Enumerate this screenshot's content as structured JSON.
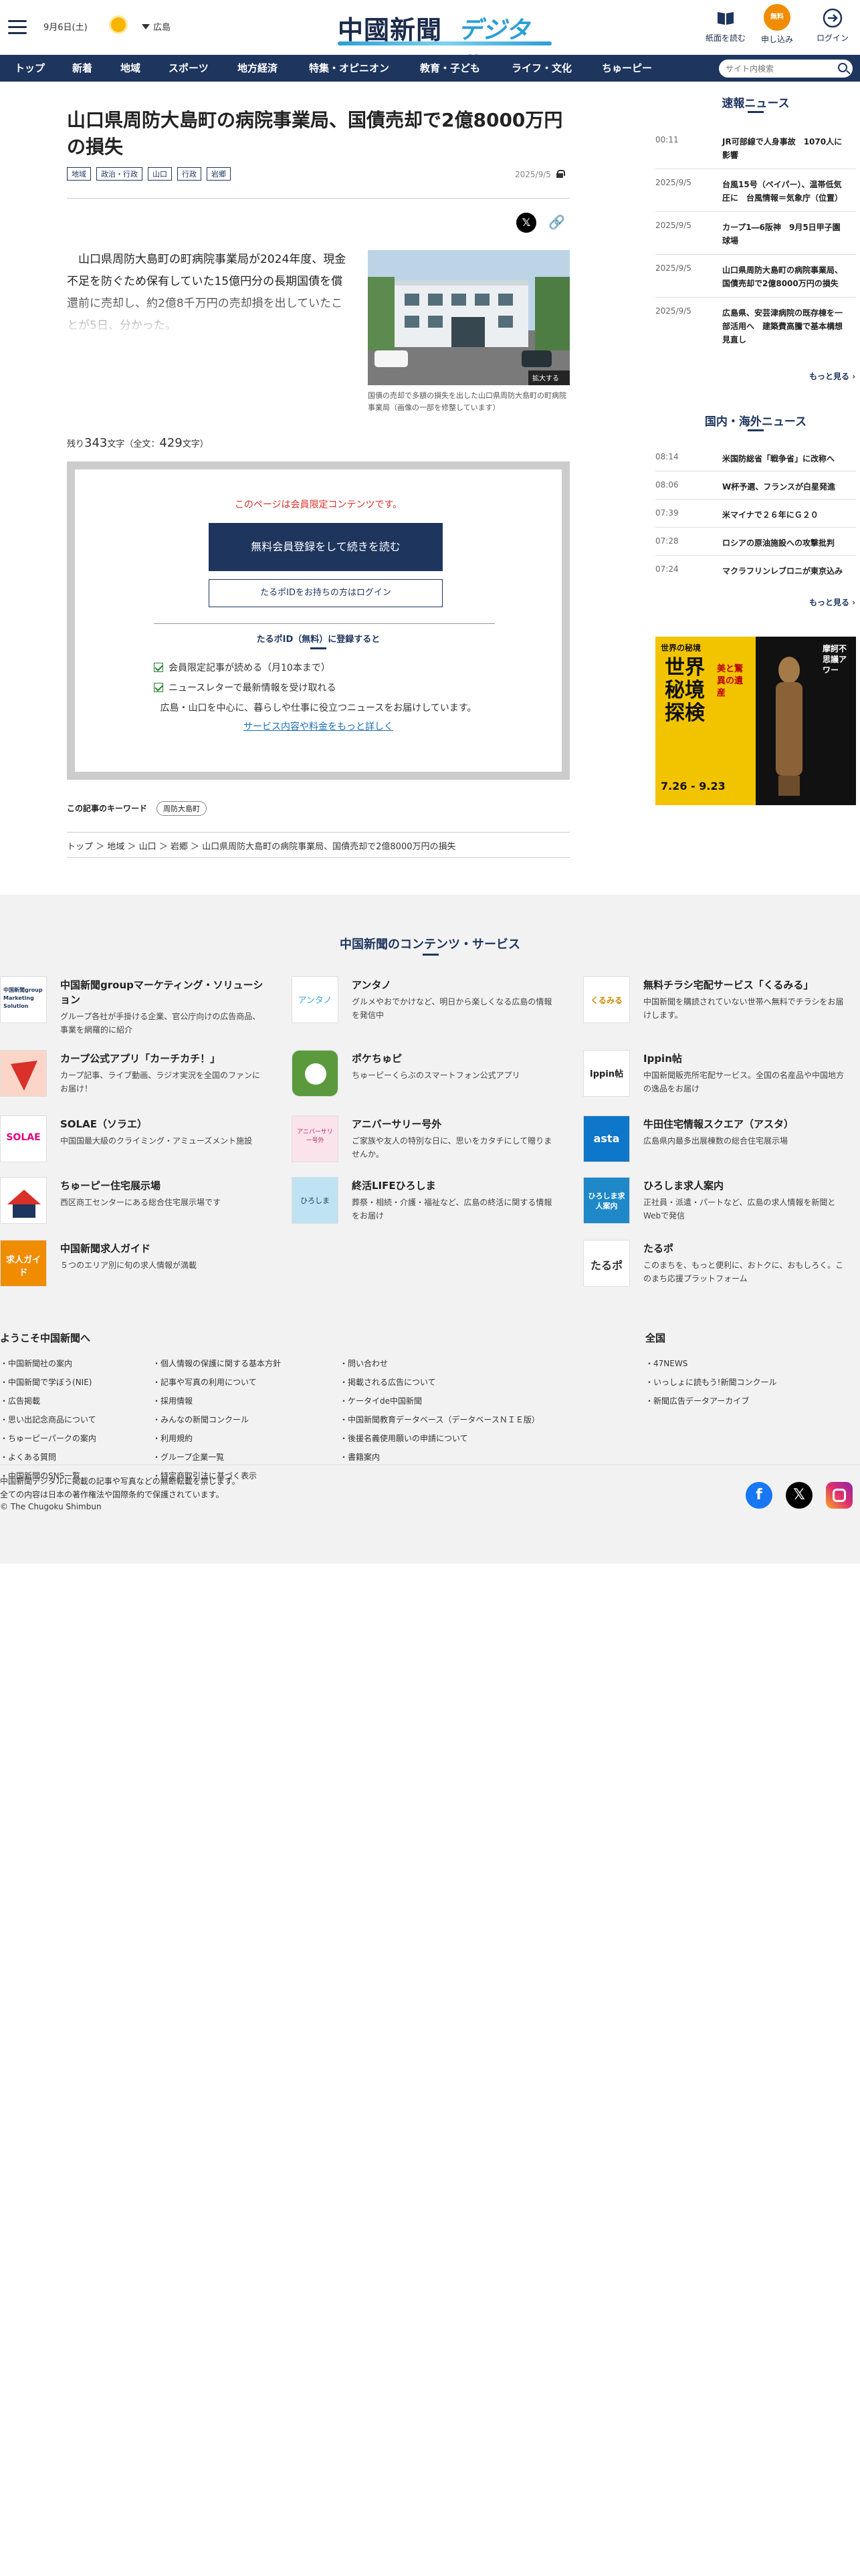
{
  "header": {
    "date": "9月6日(土)",
    "region": "広島",
    "logo_kanji": "中國新聞",
    "logo_kana": "デジタル",
    "buttons": {
      "paper": "紙面を読む",
      "signup": "申し込み",
      "signup_badge": "無料",
      "login": "ログイン"
    }
  },
  "nav": {
    "items": [
      "トップ",
      "新着",
      "地域",
      "スポーツ",
      "地方経済",
      "特集・オピニオン",
      "教育・子ども",
      "ライフ・文化",
      "ちゅーピー"
    ],
    "search_placeholder": "サイト内検索"
  },
  "article": {
    "title": "山口県周防大島町の病院事業局、国債売却で2億8000万円の損失",
    "tags": [
      "地域",
      "政治・行政",
      "山口",
      "行政",
      "岩郷"
    ],
    "date": "2025/9/5",
    "lead": "　山口県周防大島町の町病院事業局が2024年度、現金不足を防ぐため保有していた15億円分の長期国債を償還前に売却し、約2億8千万円の売却損を出していたことが5日、分かった。",
    "photo_caption": "国債の売却で多額の損失を出した山口県周防大島町の町病院事業局（画像の一部を修整しています）",
    "photo_zoom": "拡大する",
    "remain_prefix": "残り",
    "remain_count": "343",
    "remain_mid": "文字（全文：",
    "total_count": "429",
    "remain_suffix": "文字）"
  },
  "paywall": {
    "notice": "このページは会員限定コンテンツです。",
    "register_button": "無料会員登録をして続きを読む",
    "login_button": "たるポIDをお持ちの方はログイン",
    "benefits_title": "たるポID（無料）に登録すると",
    "benefit1": "会員限定記事が読める（月10本まで）",
    "benefit2": "ニュースレターで最新情報を受け取れる",
    "description": "広島・山口を中心に、暮らしや仕事に役立つニュースをお届けしています。",
    "more_link": "サービス内容や料金をもっと詳しく"
  },
  "keywords": {
    "label": "この記事のキーワード",
    "tag": "周防大島町"
  },
  "breadcrumb": [
    "トップ",
    "地域",
    "山口",
    "岩郷",
    "山口県周防大島町の病院事業局、国債売却で2億8000万円の損失"
  ],
  "sidebar": {
    "breaking_title": "速報ニュース",
    "breaking": [
      {
        "time": "00:11",
        "headline": "JR可部線で人身事故　1070人に影響"
      },
      {
        "time": "2025/9/5",
        "headline": "台風15号（ペイパー）、温帯低気圧に　台風情報＝気象庁（位置）"
      },
      {
        "time": "2025/9/5",
        "headline": "カープ1―6阪神　9月5日甲子園球場"
      },
      {
        "time": "2025/9/5",
        "headline": "山口県周防大島町の病院事業局、国債売却で2億8000万円の損失"
      },
      {
        "time": "2025/9/5",
        "headline": "広島県、安芸津病院の既存棟を一部活用へ　建築費高騰で基本構想見直し"
      }
    ],
    "more": "もっと見る",
    "world_title": "国内・海外ニュース",
    "world": [
      {
        "time": "08:14",
        "headline": "米国防総省「戦争省」に改称へ"
      },
      {
        "time": "08:06",
        "headline": "W杯予選、フランスが白星発進"
      },
      {
        "time": "07:39",
        "headline": "米マイナで２６年にＧ２０"
      },
      {
        "time": "07:28",
        "headline": "ロシアの原油施設への攻撃批判"
      },
      {
        "time": "07:24",
        "headline": "マクラフリンレブロニが東京込み"
      }
    ],
    "ad": {
      "top": "世界の秘境",
      "main": "世界秘境探検",
      "sub": "美と驚異の遺産",
      "dates": "7.26 - 9.23",
      "right": "摩訶不思議アワー"
    }
  },
  "footer": {
    "title": "中国新聞のコンテンツ・サービス",
    "services": [
      {
        "name": "中国新聞groupマーケティング・ソリューション",
        "desc": "グループ各社が手掛ける企業、官公庁向けの広告商品、事業を網羅的に紹介",
        "icon_text": "中国新聞group Marketing Solution"
      },
      {
        "name": "アンタノ",
        "desc": "グルメやおでかけなど、明日から楽しくなる広島の情報を発信中",
        "icon_text": "アンタノ"
      },
      {
        "name": "無料チラシ宅配サービス「くるみる」",
        "desc": "中国新聞を購読されていない世帯へ無料でチラシをお届けします。",
        "icon_text": "くるみる"
      },
      {
        "name": "カープ公式アプリ「カーチカチ！」",
        "desc": "カープ記事、ライブ動画、ラジオ実況を全国のファンにお届け！",
        "icon_text": ""
      },
      {
        "name": "ポケちゅピ",
        "desc": "ちゅーピーくらぶのスマートフォン公式アプリ",
        "icon_text": ""
      },
      {
        "name": "Ippin帖",
        "desc": "中国新聞販売所宅配サービス。全国の名産品や中国地方の逸品をお届け",
        "icon_text": "Ippin帖"
      },
      {
        "name": "SOLAE（ソラエ）",
        "desc": "中国国最大級のクライミング・アミューズメント施設",
        "icon_text": "SOLAE"
      },
      {
        "name": "アニバーサリー号外",
        "desc": "ご家族や友人の特別な日に、思いをカタチにして贈りませんか。",
        "icon_text": "アニバーサリー号外"
      },
      {
        "name": "牛田住宅情報スクエア（アスタ）",
        "desc": "広島県内最多出展棟数の総合住宅展示場",
        "icon_text": "asta"
      },
      {
        "name": "ちゅーピー住宅展示場",
        "desc": "西区商工センターにある総合住宅展示場です",
        "icon_text": ""
      },
      {
        "name": "終活LIFEひろしま",
        "desc": "葬祭・相続・介護・福祉など、広島の終活に関する情報をお届け",
        "icon_text": "ひろしま"
      },
      {
        "name": "ひろしま求人案内",
        "desc": "正社員・派遣・パートなど、広島の求人情報を新聞とWebで発信",
        "icon_text": "ひろしま求人案内"
      },
      {
        "name": "中国新聞求人ガイド",
        "desc": "５つのエリア別に旬の求人情報が満載",
        "icon_text": "求人ガイド"
      },
      {
        "name": "たるポ",
        "desc": "このまちを、もっと便利に、おトクに、おもしろく。このまち応援プラットフォーム",
        "icon_text": "たるポ"
      }
    ],
    "welcome_title": "ようこそ中国新聞へ",
    "col1": [
      "中国新聞社の案内",
      "中国新聞で学ぼう(NIE)",
      "広告掲載",
      "思い出記念商品について",
      "ちゅーピーパークの案内",
      "よくある質問",
      "中国新聞のSNS一覧"
    ],
    "col2": [
      "個人情報の保護に関する基本方針",
      "記事や写真の利用について",
      "採用情報",
      "みんなの新聞コンクール",
      "利用規約",
      "グループ企業一覧",
      "特定商取引法に基づく表示"
    ],
    "col3": [
      "問い合わせ",
      "掲載される広告について",
      "ケータイde中国新聞",
      "中国新聞教育データベース（データベースＮＩＥ版）",
      "後援名義使用願いの申請について",
      "書籍案内"
    ],
    "national_title": "全国",
    "col4": [
      "47NEWS",
      "いっしょに読もう!新聞コンクール",
      "新聞広告データアーカイブ"
    ],
    "copyright1": "中国新聞デジタルに掲載の記事や写真などの無断転載を禁じます。",
    "copyright2": "全ての内容は日本の著作権法や国際条約で保護されています。",
    "copyright3": "© The Chugoku Shimbun"
  },
  "colors": {
    "navy": "#1e355e",
    "accent_red": "#d9302a",
    "orange": "#f08c00"
  }
}
